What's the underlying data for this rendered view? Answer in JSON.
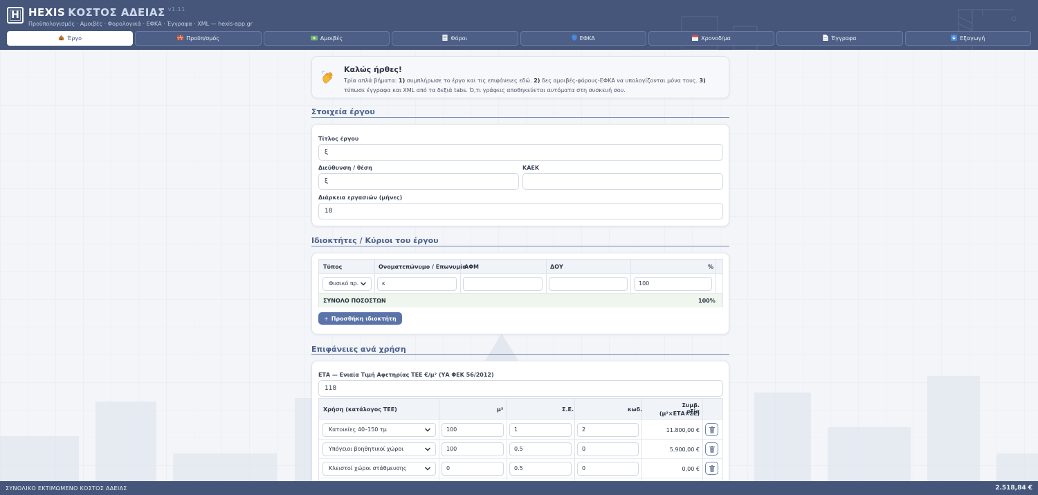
{
  "app": {
    "logo_letter": "H",
    "title_brand": "HEXIS",
    "title_main": "ΚΟΣΤΟΣ ΑΔΕΙΑΣ",
    "version": "v1.11",
    "subtitle": "Προϋπολογισμός · Αμοιβές · Φορολογικά · ΕΦΚΑ · Έγγραφα · XML — hexis-app.gr"
  },
  "tabs": [
    {
      "label": "Έργο",
      "icon": "house-icon",
      "active": true
    },
    {
      "label": "Προϋπ/σμός",
      "icon": "bricks-icon"
    },
    {
      "label": "Αμοιβές",
      "icon": "money-icon"
    },
    {
      "label": "Φόροι",
      "icon": "document-icon"
    },
    {
      "label": "ΕΦΚΑ",
      "icon": "shield-icon"
    },
    {
      "label": "Χρονοδ/μα",
      "icon": "calendar-icon"
    },
    {
      "label": "Έγγραφα",
      "icon": "page-icon"
    },
    {
      "label": "Εξαγωγή",
      "icon": "download-icon"
    }
  ],
  "welcome": {
    "title": "Καλώς ήρθες!",
    "intro": "Τρία απλά βήματα: ",
    "n1": "1)",
    "s1": " συμπλήρωσε το έργο και τις επιφάνειες εδώ. ",
    "n2": "2)",
    "s2": " δες αμοιβές-φόρους-ΕΦΚΑ να υπολογίζονται μόνα τους. ",
    "n3": "3)",
    "s3": " τύπωσε έγγραφα και XML από τα δεξιά tabs. Ό,τι γράφεις αποθηκεύεται αυτόματα στη συσκευή σου."
  },
  "project": {
    "section_title": "Στοιχεία έργου",
    "title_label": "Τίτλος έργου",
    "title_value": "ξ",
    "address_label": "Διεύθυνση / θέση",
    "address_value": "ξ",
    "kaek_label": "ΚΑΕΚ",
    "kaek_value": "",
    "duration_label": "Διάρκεια εργασιών (μήνες)",
    "duration_value": "18"
  },
  "owners": {
    "section_title": "Ιδιοκτήτες / Κύριοι του έργου",
    "headers": {
      "type": "Τύπος",
      "name": "Ονοματεπώνυμο / Επωνυμία",
      "afm": "ΑΦΜ",
      "doy": "ΔΟΥ",
      "pct": "%"
    },
    "rows": [
      {
        "type": "Φυσικό πρ.",
        "name": "κ",
        "afm": "",
        "doy": "",
        "pct": "100"
      }
    ],
    "total_label": "ΣΥΝΟΛΟ ΠΟΣΟΣΤΩΝ",
    "total_value": "100%",
    "add_button": "Προσθήκη ιδιοκτήτη",
    "add_icon": "+"
  },
  "surfaces": {
    "section_title": "Επιφάνειες ανά χρήση",
    "eta_label": "ΕΤΑ — Ενιαία Τιμή Αφετηρίας ΤΕΕ €/μ² (ΥΑ ΦΕΚ 56/2012)",
    "eta_value": "118",
    "headers": {
      "use": "Χρήση (κατάλογος ΤΕΕ)",
      "m2": "μ²",
      "se": "Σ.Ε.",
      "code": "κωδ.",
      "value1": "Συμβ. αξία",
      "value2": "(μ²×ΕΤΑ×ΣΕ)"
    },
    "rows": [
      {
        "use": "Κατοικίες 40–150 τμ",
        "m2": "100",
        "se": "1",
        "code": "2",
        "value": "11.800,00 €"
      },
      {
        "use": "Υπόγειοι βοηθητικοί χώροι",
        "m2": "100",
        "se": "0.5",
        "code": "0",
        "value": "5.900,00 €"
      },
      {
        "use": "Κλειστοί χώροι στάθμευσης",
        "m2": "0",
        "se": "0.5",
        "code": "0",
        "value": "0,00 €"
      }
    ]
  },
  "footer": {
    "label": "ΣΥΝΟΛΙΚΟ ΕΚΤΙΜΩΜΕΝΟ ΚΟΣΤΟΣ ΑΔΕΙΑΣ",
    "value": "2.518,84 €"
  },
  "colors": {
    "header": "#45567a",
    "accent": "#5a73a8",
    "total_row": "#eef6ee"
  }
}
